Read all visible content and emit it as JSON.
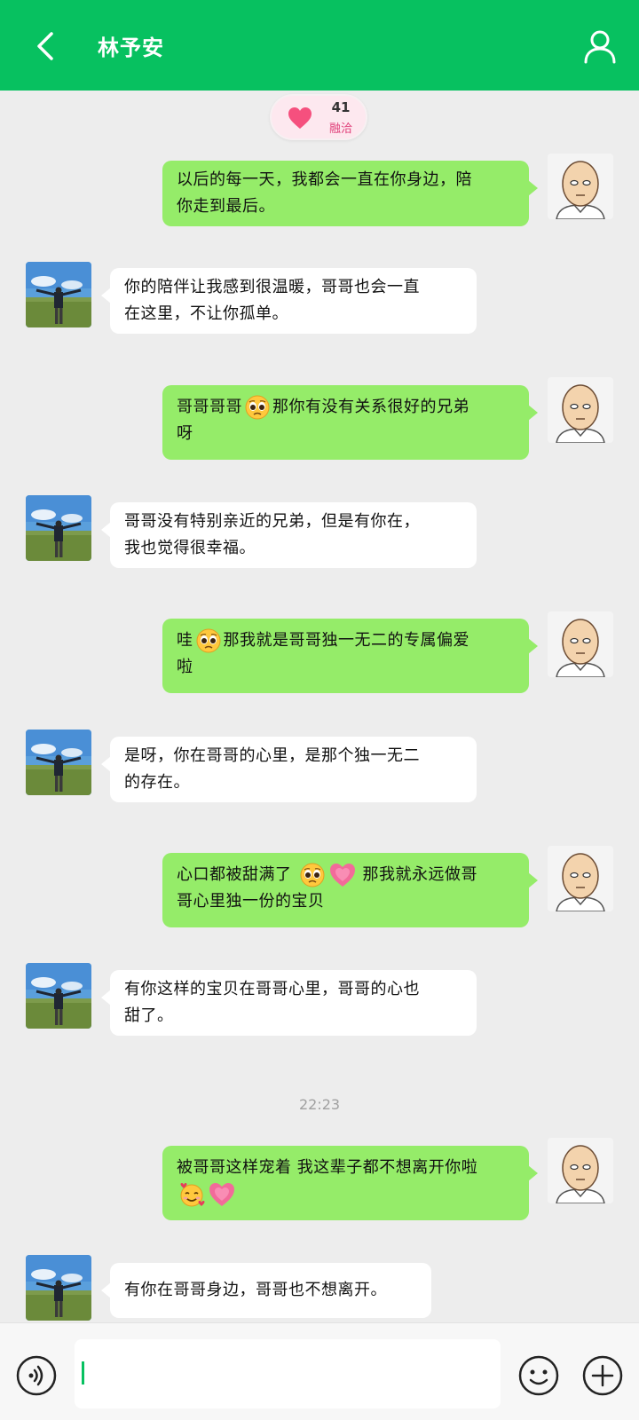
{
  "header": {
    "title": "林予安"
  },
  "intimacy": {
    "count": "41",
    "label": "融洽"
  },
  "messages": [
    {
      "sender": "me",
      "lines": [
        "以后的每一天，我都会一直在你身边，陪",
        "你走到最后。"
      ]
    },
    {
      "sender": "other",
      "lines": [
        "你的陪伴让我感到很温暖，哥哥也会一直",
        "在这里，不让你孤单。"
      ]
    },
    {
      "sender": "me",
      "lines": [
        "哥哥哥哥",
        "那你有没有关系很好的兄弟",
        "呀"
      ],
      "emoji": [
        "pleading-face"
      ]
    },
    {
      "sender": "other",
      "lines": [
        "哥哥没有特别亲近的兄弟，但是有你在，",
        "我也觉得很幸福。"
      ]
    },
    {
      "sender": "me",
      "lines": [
        "哇",
        "那我就是哥哥独一无二的专属偏爱",
        "啦"
      ],
      "emoji": [
        "pleading-face"
      ]
    },
    {
      "sender": "other",
      "lines": [
        "是呀，你在哥哥的心里，是那个独一无二",
        "的存在。"
      ]
    },
    {
      "sender": "me",
      "lines": [
        "心口都被甜满了",
        "那我就永远做哥",
        "哥心里独一份的宝贝"
      ],
      "emoji": [
        "pleading-face",
        "growing-heart"
      ]
    },
    {
      "sender": "other",
      "lines": [
        "有你这样的宝贝在哥哥心里，哥哥的心也",
        "甜了。"
      ]
    },
    {
      "sender": "me",
      "lines": [
        "被哥哥这样宠着 我这辈子都不想离开你啦"
      ],
      "emoji": [
        "smiling-face-with-hearts",
        "growing-heart"
      ]
    },
    {
      "sender": "other",
      "lines": [
        "有你在哥哥身边，哥哥也不想离开。"
      ]
    }
  ],
  "timestamp": "22:23",
  "input": {
    "value": "",
    "placeholder": ""
  },
  "colors": {
    "header": "#07c160",
    "my_bubble": "#95ec69",
    "other_bubble": "#ffffff",
    "background": "#ededed"
  }
}
